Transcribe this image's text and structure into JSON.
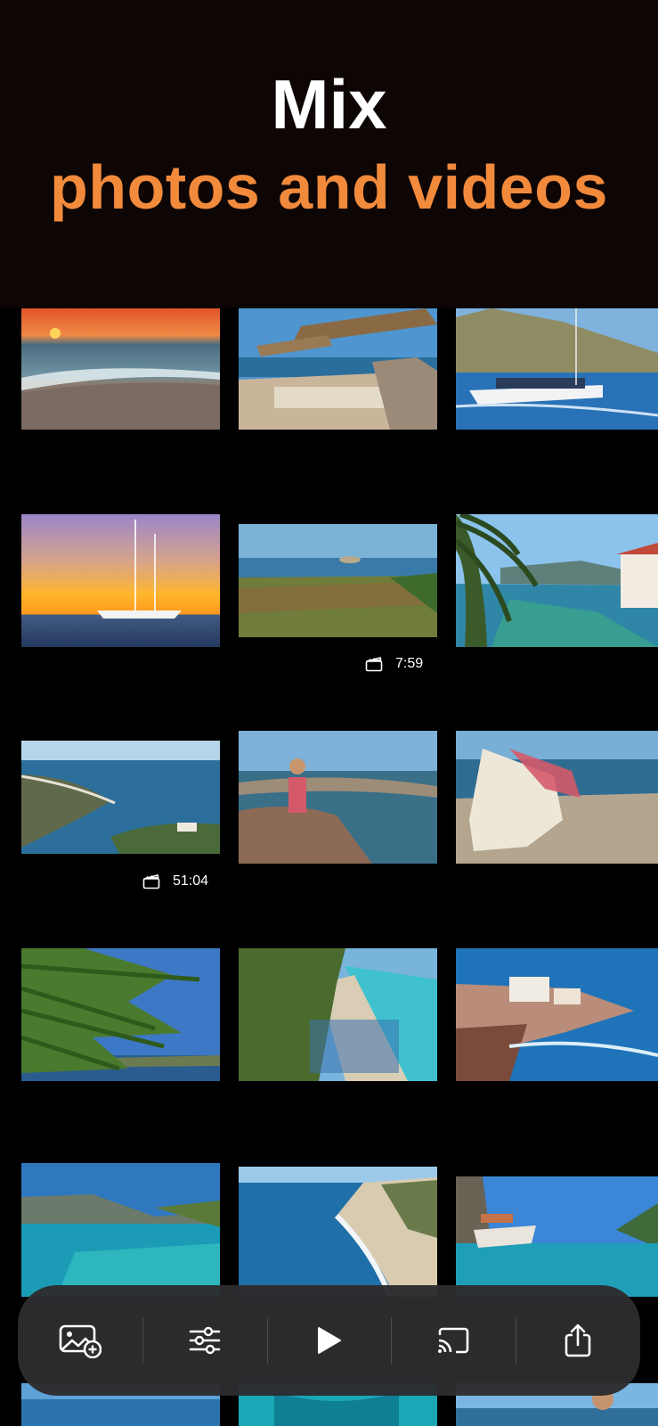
{
  "hero": {
    "line1": "Mix",
    "line2": "photos and videos",
    "line1_color": "#ffffff",
    "line2_color": "#f28a3c"
  },
  "grid": {
    "rows": [
      {
        "tiles": [
          {
            "name": "photo-sunset-pebble-beach",
            "video": false
          },
          {
            "name": "photo-beach-cafe-umbrellas",
            "video": false
          },
          {
            "name": "photo-tour-boat",
            "video": false
          }
        ]
      },
      {
        "tiles": [
          {
            "name": "photo-sailboat-sunset",
            "video": false
          },
          {
            "name": "video-coastal-fields",
            "video": true,
            "duration": "7:59"
          },
          {
            "name": "photo-palm-bay-house",
            "video": false
          }
        ]
      },
      {
        "tiles": [
          {
            "name": "video-rocky-cove",
            "video": true,
            "duration": "51:04"
          },
          {
            "name": "photo-woman-on-rock",
            "video": false
          },
          {
            "name": "photo-sunbed-beach",
            "video": false
          }
        ]
      },
      {
        "tiles": [
          {
            "name": "photo-palm-fronds-sky",
            "video": false
          },
          {
            "name": "photo-turquoise-beach-umbrellas",
            "video": false
          },
          {
            "name": "photo-seaside-village",
            "video": false
          }
        ]
      },
      {
        "tiles": [
          {
            "name": "photo-turquoise-bay",
            "video": false
          },
          {
            "name": "photo-cliff-beach-aerial",
            "video": false
          },
          {
            "name": "photo-cliff-jumper-boat",
            "video": false
          }
        ]
      }
    ]
  },
  "toolbar": {
    "items": [
      {
        "name": "add-photo-button",
        "icon": "add-photo-icon"
      },
      {
        "name": "adjust-button",
        "icon": "sliders-icon"
      },
      {
        "name": "play-button",
        "icon": "play-icon"
      },
      {
        "name": "cast-button",
        "icon": "cast-icon"
      },
      {
        "name": "share-button",
        "icon": "share-icon"
      }
    ]
  }
}
